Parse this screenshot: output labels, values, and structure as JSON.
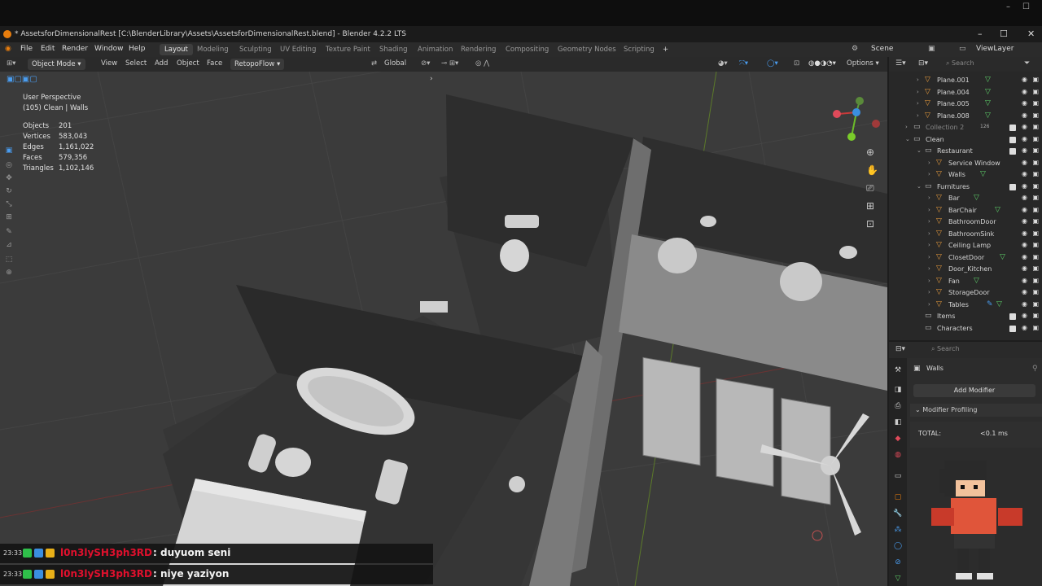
{
  "os": {
    "minimize": "–",
    "maximize": "☐",
    "close": "✕"
  },
  "window": {
    "title": "* AssetsforDimensionalRest [C:\\BlenderLibrary\\Assets\\AssetsforDimensionalRest.blend] - Blender 4.2.2 LTS"
  },
  "menu": {
    "items": [
      "File",
      "Edit",
      "Render",
      "Window",
      "Help"
    ],
    "workspaces": [
      "Layout",
      "Modeling",
      "Sculpting",
      "UV Editing",
      "Texture Paint",
      "Shading",
      "Animation",
      "Rendering",
      "Compositing",
      "Geometry Nodes",
      "Scripting"
    ],
    "active_workspace": "Layout",
    "add_tab": "+",
    "scene": "Scene",
    "view_layer": "ViewLayer"
  },
  "viewport_header": {
    "mode": "Object Mode",
    "menus": [
      "View",
      "Select",
      "Add",
      "Object",
      "Face",
      "RetopoFlow"
    ],
    "transform_orientation": "Global",
    "options": "Options"
  },
  "viewport_overlay": {
    "perspective": "User Perspective",
    "collection_info": "(105) Clean | Walls",
    "stats": [
      {
        "label": "Objects",
        "value": "201"
      },
      {
        "label": "Vertices",
        "value": "583,043"
      },
      {
        "label": "Edges",
        "value": "1,161,022"
      },
      {
        "label": "Faces",
        "value": "579,356"
      },
      {
        "label": "Triangles",
        "value": "1,102,146"
      }
    ]
  },
  "outliner": {
    "search_placeholder": "Search",
    "rows": [
      {
        "label": "Plane.001",
        "type": "object"
      },
      {
        "label": "Plane.004",
        "type": "object"
      },
      {
        "label": "Plane.005",
        "type": "object"
      },
      {
        "label": "Plane.008",
        "type": "object"
      },
      {
        "label": "Collection 2",
        "type": "collection",
        "extra": "126"
      },
      {
        "label": "Clean",
        "type": "collection"
      },
      {
        "label": "Restaurant",
        "type": "collection"
      },
      {
        "label": "Service Window",
        "type": "object"
      },
      {
        "label": "Walls",
        "type": "object"
      },
      {
        "label": "Furnitures",
        "type": "collection"
      },
      {
        "label": "Bar",
        "type": "object"
      },
      {
        "label": "BarChair",
        "type": "object"
      },
      {
        "label": "BathroomDoor",
        "type": "object"
      },
      {
        "label": "BathroomSink",
        "type": "object"
      },
      {
        "label": "Ceiling Lamp",
        "type": "object"
      },
      {
        "label": "ClosetDoor",
        "type": "object"
      },
      {
        "label": "Door_Kitchen",
        "type": "object"
      },
      {
        "label": "Fan",
        "type": "object"
      },
      {
        "label": "StorageDoor",
        "type": "object"
      },
      {
        "label": "Tables",
        "type": "object"
      },
      {
        "label": "Items",
        "type": "collection"
      },
      {
        "label": "Characters",
        "type": "collection"
      }
    ]
  },
  "properties": {
    "search_placeholder": "Search",
    "object_name": "Walls",
    "add_modifier": "Add Modifier",
    "modifier_profiling": "Modifier Profiling",
    "total_label": "TOTAL:",
    "total_value": "<0.1 ms"
  },
  "chat": [
    {
      "time": "23:33",
      "user": "l0n3lySH3ph3RD",
      "message": ": duyuom seni"
    },
    {
      "time": "23:33",
      "user": "l0n3lySH3ph3RD",
      "message": ": niye yaziyon"
    }
  ],
  "colors": {
    "accent": "#e87d0d",
    "chat_user": "#e0102d",
    "object_icon": "#e89b3c",
    "mesh_icon": "#5ed16a"
  }
}
